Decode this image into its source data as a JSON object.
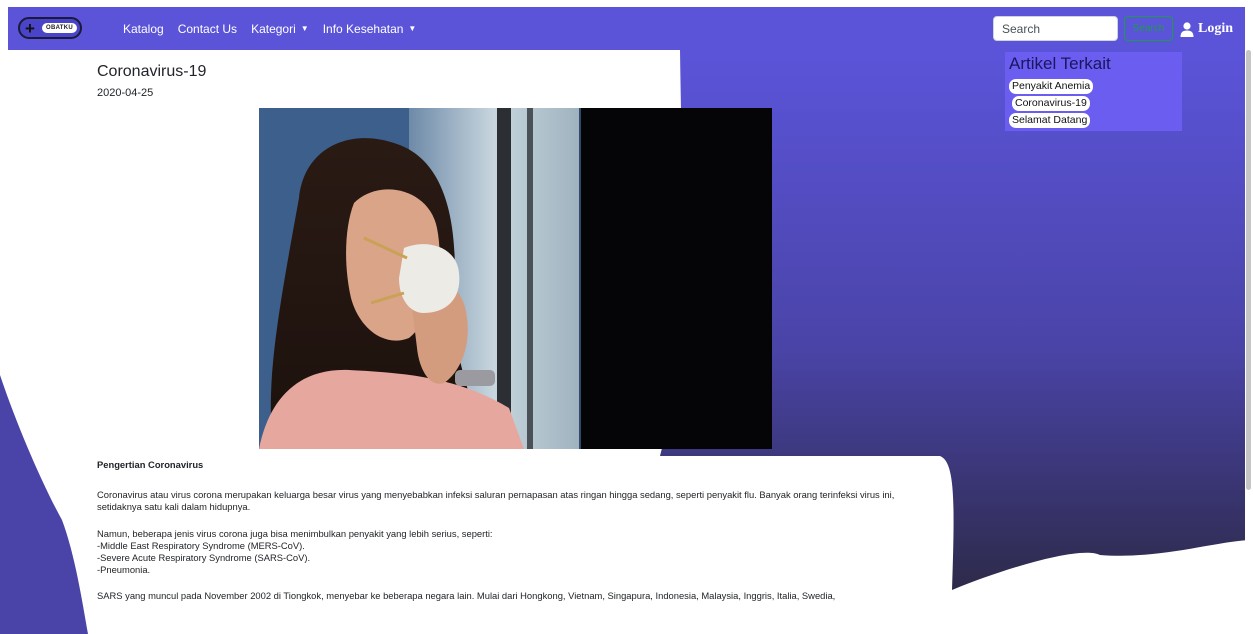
{
  "brand": {
    "logo_text": "OBATKU",
    "logo_symbol": "+"
  },
  "nav": {
    "links": [
      {
        "label": "Katalog"
      },
      {
        "label": "Contact Us"
      },
      {
        "label": "Kategori",
        "dropdown": true
      },
      {
        "label": "Info Kesehatan",
        "dropdown": true
      }
    ],
    "search_placeholder": "Search",
    "search_button": "Search",
    "login_label": "Login"
  },
  "article": {
    "title": "Coronavirus-19",
    "date": "2020-04-25",
    "section_heading": "Pengertian Coronavirus",
    "paragraphs": [
      "Coronavirus atau virus corona merupakan keluarga besar virus yang menyebabkan infeksi saluran pernapasan atas ringan hingga sedang, seperti penyakit flu. Banyak orang terinfeksi virus ini, setidaknya satu kali dalam hidupnya.",
      "Namun, beberapa jenis virus corona juga bisa menimbulkan penyakit yang lebih serius, seperti:",
      "-Middle East Respiratory Syndrome (MERS-CoV).",
      "-Severe Acute Respiratory Syndrome (SARS-CoV).",
      "-Pneumonia.",
      "SARS yang muncul pada November 2002 di Tiongkok, menyebar ke beberapa negara lain. Mulai dari Hongkong, Vietnam, Singapura, Indonesia, Malaysia, Inggris, Italia, Swedia,"
    ]
  },
  "related": {
    "title": "Artikel Terkait",
    "items": [
      "Penyakit Anemia",
      "Coronavirus-19",
      "Selamat Datang"
    ]
  },
  "colors": {
    "navbar": "#5b54d9",
    "accent": "#6a5df0",
    "search_button": "#1e9a4e",
    "gradient_top": "#5b54d9",
    "gradient_bottom": "#2d2a4a"
  },
  "icons": {
    "logo": "plus-icon",
    "login": "user-icon",
    "dropdown": "caret-down-icon"
  }
}
